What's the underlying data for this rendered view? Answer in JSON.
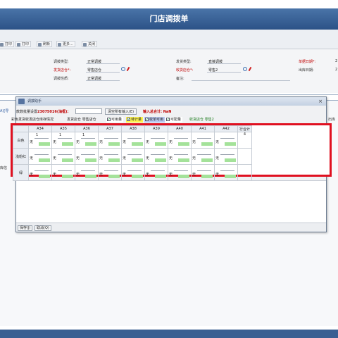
{
  "window": {
    "title": "门店调拨单"
  },
  "toolbar": {
    "buttons": [
      {
        "label": "打印"
      },
      {
        "label": "打印"
      },
      {
        "label": "刷新"
      },
      {
        "label": "更多..."
      },
      {
        "label": "关闭"
      }
    ]
  },
  "form": {
    "left": [
      {
        "label": "调拨类型:",
        "value": "正常调拨",
        "required": false
      },
      {
        "label": "发货店仓*:",
        "value": "零售店仓",
        "required": true
      },
      {
        "label": "调拨性质:",
        "value": "正常调拨",
        "required": false
      }
    ],
    "middle": [
      {
        "label": "发货类型:",
        "value": "直接调拨",
        "required": false
      },
      {
        "label": "收货店仓*:",
        "value": "零售2",
        "required": true
      },
      {
        "label": "备注:",
        "value": "",
        "required": false
      }
    ],
    "right": [
      {
        "label": "单据日期*:",
        "value": "2",
        "required": true
      },
      {
        "label": "出库日期:",
        "value": "2",
        "required": false
      }
    ]
  },
  "side_bits": {
    "left_a": "A)[导",
    "left_b": "库信",
    "right_a": "出库"
  },
  "dialog": {
    "title": "调拨助手",
    "close": "×",
    "batch_label_prefix": "款数批量设置",
    "batch_label_code": "23075016(油框):",
    "batch_button": "清空所有输入(E)",
    "total_label": "输入总合计: NaN",
    "legend_caption": "彩色发货收发店仓库存情况",
    "legend_items": [
      {
        "label": "发货店仓 零售店仓"
      },
      {
        "label": "可用量"
      },
      {
        "label": "待计量"
      },
      {
        "label": "收单可用"
      },
      {
        "label": "可配量"
      },
      {
        "label": "收货店仓 零售2"
      }
    ],
    "grid": {
      "sizes": [
        "A34",
        "A35",
        "A36",
        "A37",
        "A38",
        "A39",
        "A40",
        "A41",
        "A42"
      ],
      "total_header": "行合计",
      "rows": [
        {
          "color": "白色",
          "inputs": [
            "1",
            "1",
            "1",
            "",
            "",
            "",
            "",
            "",
            ""
          ],
          "marks": [
            "无",
            "无",
            "无",
            "无",
            "无",
            "无",
            "无",
            "无",
            "无"
          ],
          "total": "4"
        },
        {
          "color": "浅粉红",
          "inputs": [
            "",
            "",
            "",
            "",
            "",
            "",
            "",
            "",
            ""
          ],
          "marks": [
            "无",
            "无",
            "无",
            "无",
            "无",
            "无",
            "无",
            "无",
            "无"
          ],
          "total": ""
        },
        {
          "color": "绿",
          "inputs": [
            "",
            "",
            "",
            "",
            "",
            "",
            "",
            "",
            ""
          ],
          "marks": [
            "无",
            "无",
            "无",
            "无",
            "无",
            "无",
            "无",
            "无",
            "无"
          ],
          "total": ""
        }
      ]
    },
    "footer": {
      "save": "保存(J)",
      "cancel": "取消(Q)"
    }
  },
  "colors": {
    "titlebar": "#3a6298",
    "highlight_frame": "#e01020",
    "available": "#a4e29a",
    "required_label": "#c00000"
  }
}
